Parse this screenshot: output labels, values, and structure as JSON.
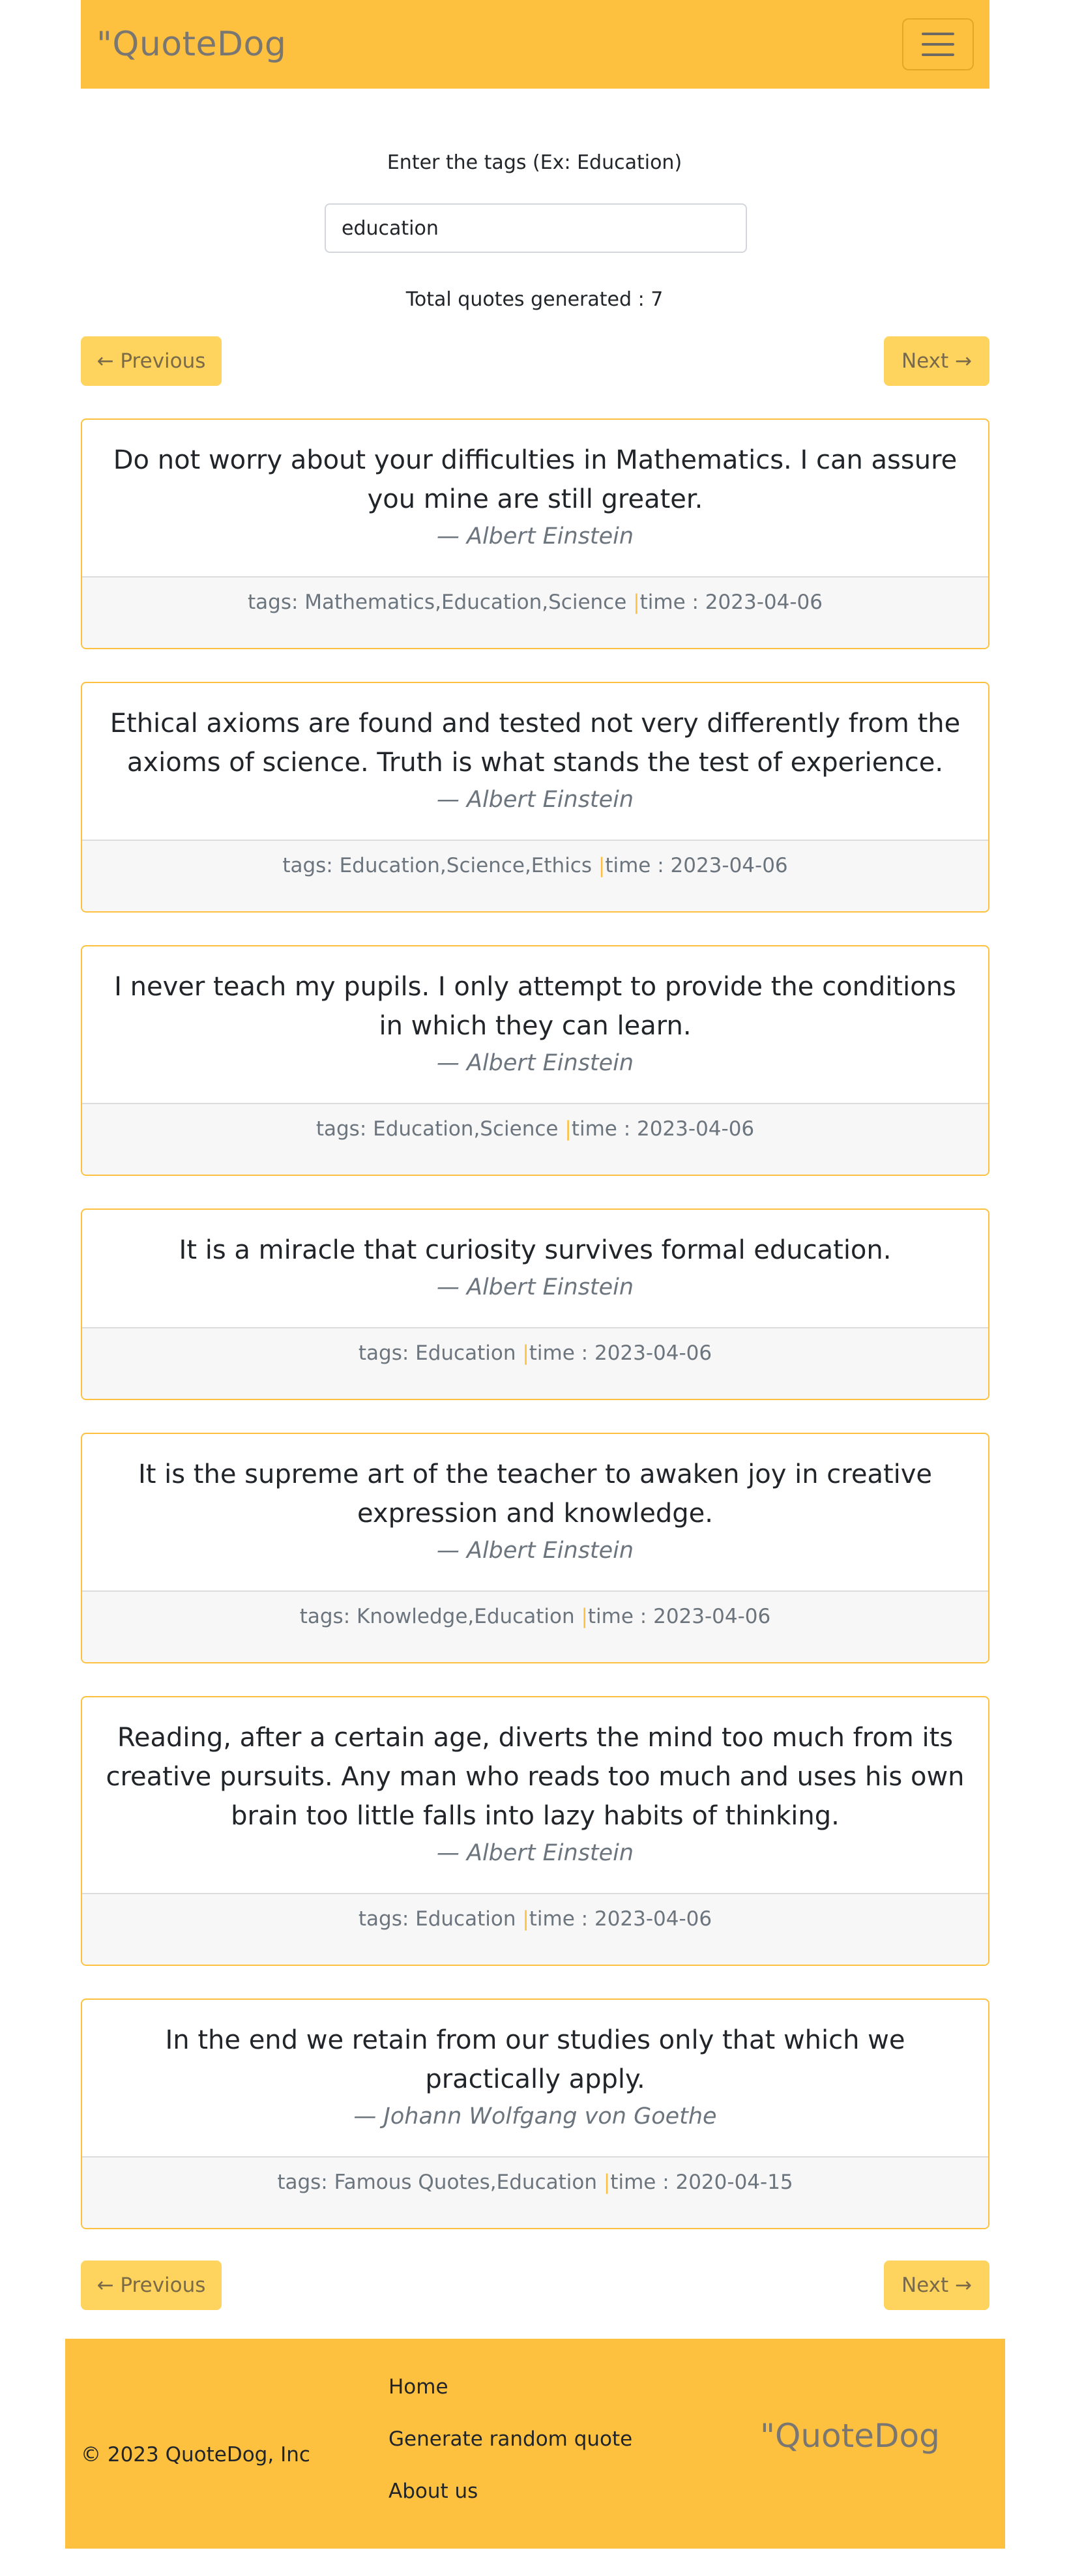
{
  "navbar": {
    "brand": "\"QuoteDog",
    "menu_icon": "hamburger-menu-icon"
  },
  "search": {
    "label": "Enter the tags (Ex: Education)",
    "value": "education"
  },
  "summary": {
    "total_text": "Total quotes generated : 7"
  },
  "pager": {
    "previous_label": "← Previous",
    "next_label": "Next →"
  },
  "quotes": [
    {
      "text": "Do not worry about your difficulties in Mathematics. I can assure you mine are still greater.",
      "author": "— Albert Einstein",
      "tags": "tags: Mathematics,Education,Science ",
      "time": "time : 2023-04-06"
    },
    {
      "text": "Ethical axioms are found and tested not very differently from the axioms of science. Truth is what stands the test of experience.",
      "author": "— Albert Einstein",
      "tags": "tags: Education,Science,Ethics ",
      "time": "time : 2023-04-06"
    },
    {
      "text": "I never teach my pupils. I only attempt to provide the conditions in which they can learn.",
      "author": "— Albert Einstein",
      "tags": "tags: Education,Science ",
      "time": "time : 2023-04-06"
    },
    {
      "text": "It is a miracle that curiosity survives formal education.",
      "author": "— Albert Einstein",
      "tags": "tags: Education ",
      "time": "time : 2023-04-06"
    },
    {
      "text": "It is the supreme art of the teacher to awaken joy in creative expression and knowledge.",
      "author": "— Albert Einstein",
      "tags": "tags: Knowledge,Education ",
      "time": "time : 2023-04-06"
    },
    {
      "text": "Reading, after a certain age, diverts the mind too much from its creative pursuits. Any man who reads too much and uses his own brain too little falls into lazy habits of thinking.",
      "author": "— Albert Einstein",
      "tags": "tags: Education ",
      "time": "time : 2023-04-06"
    },
    {
      "text": "In the end we retain from our studies only that which we practically apply.",
      "author": "— Johann Wolfgang von Goethe",
      "tags": "tags: Famous Quotes,Education ",
      "time": "time : 2020-04-15"
    }
  ],
  "separator": "|",
  "footer": {
    "copyright": "© 2023 QuoteDog, Inc",
    "links": [
      "Home",
      "Generate random quote",
      "About us"
    ],
    "brand": "\"QuoteDog"
  },
  "colors": {
    "accent": "#fdc13f",
    "button": "#fed45f"
  }
}
